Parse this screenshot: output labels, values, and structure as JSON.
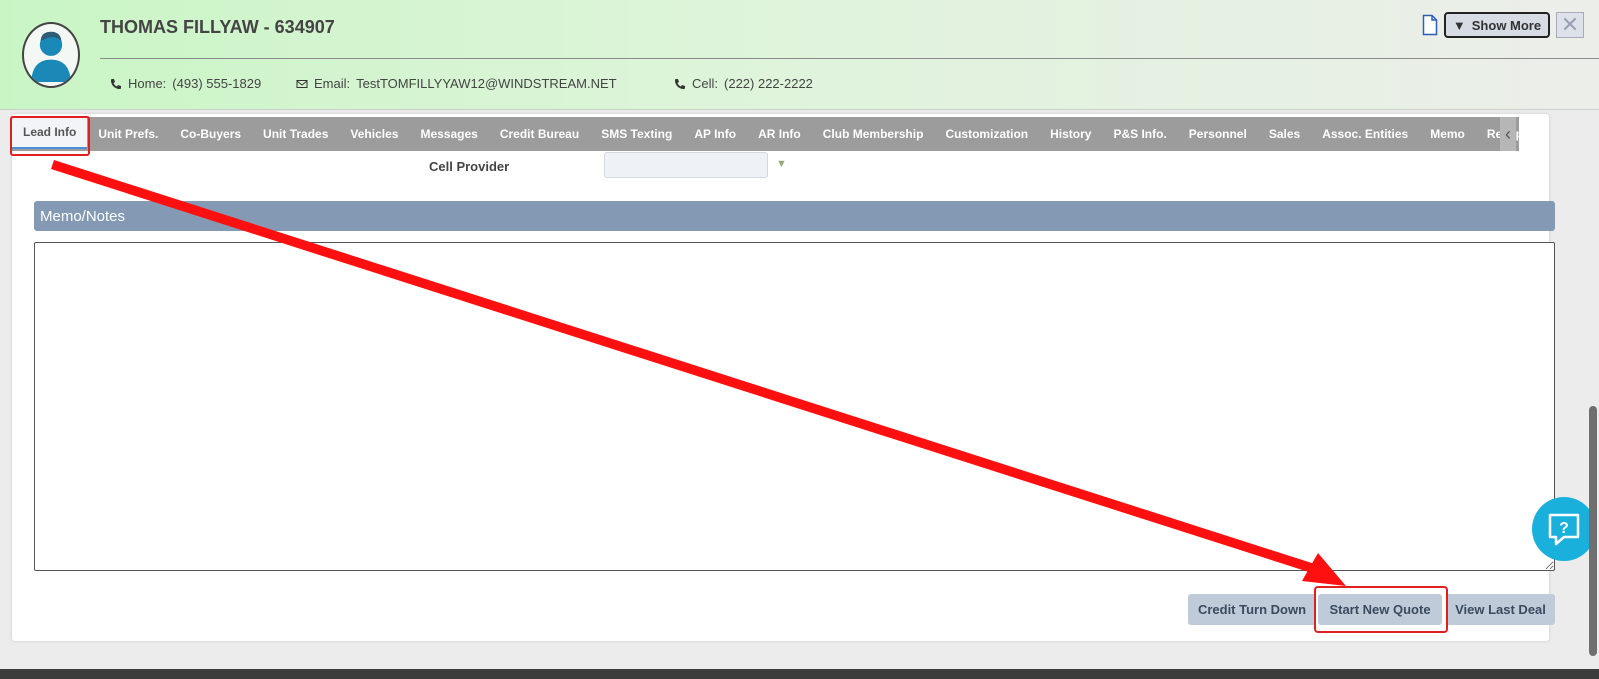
{
  "header": {
    "customer_name": "THOMAS FILLYAW - 634907",
    "home_label": "Home:",
    "home_value": "(493) 555-1829",
    "email_label": "Email:",
    "email_value": "TestTOMFILLYYAW12@WINDSTREAM.NET",
    "cell_label": "Cell:",
    "cell_value": "(222) 222-2222",
    "show_more_label": "Show More"
  },
  "tabs": [
    {
      "label": "Lead Info",
      "active": true
    },
    {
      "label": "Unit Prefs."
    },
    {
      "label": "Co-Buyers"
    },
    {
      "label": "Unit Trades"
    },
    {
      "label": "Vehicles"
    },
    {
      "label": "Messages"
    },
    {
      "label": "Credit Bureau"
    },
    {
      "label": "SMS Texting"
    },
    {
      "label": "AP Info"
    },
    {
      "label": "AR Info"
    },
    {
      "label": "Club Membership"
    },
    {
      "label": "Customization"
    },
    {
      "label": "History"
    },
    {
      "label": "P&S Info."
    },
    {
      "label": "Personnel"
    },
    {
      "label": "Sales"
    },
    {
      "label": "Assoc. Entities"
    },
    {
      "label": "Memo"
    },
    {
      "label": "Reception"
    }
  ],
  "form": {
    "cell_provider_label": "Cell Provider",
    "cell_provider_value": ""
  },
  "memo": {
    "heading": "Memo/Notes",
    "value": ""
  },
  "actions": {
    "credit_turn_down": "Credit Turn Down",
    "start_new_quote": "Start New Quote",
    "view_last_deal": "View Last Deal"
  },
  "colors": {
    "annotation": "#e02020",
    "memo_header": "#8499b3",
    "help_button": "#1ab0dc"
  }
}
